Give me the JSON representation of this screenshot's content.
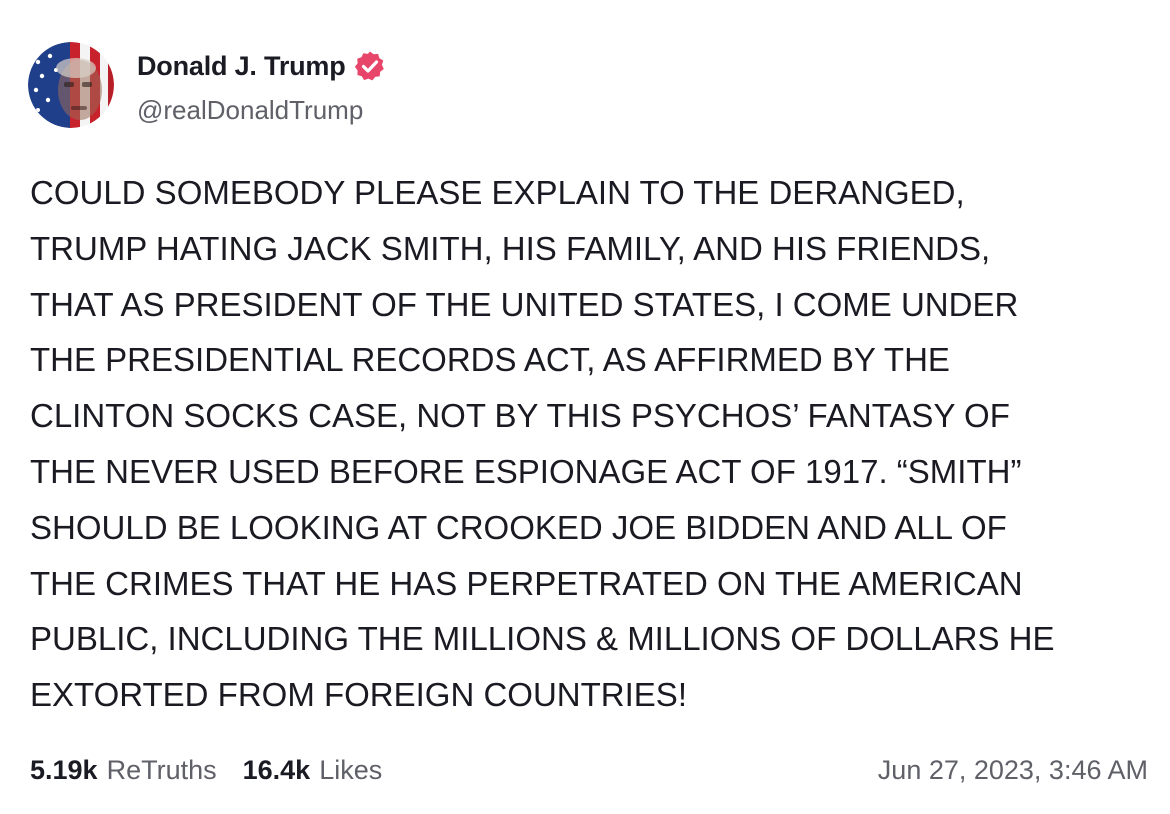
{
  "post": {
    "author": {
      "display_name": "Donald J. Trump",
      "handle": "@realDonaldTrump",
      "verified": true,
      "verified_color": "#e8456a"
    },
    "body": "COULD SOMEBODY PLEASE EXPLAIN TO THE DERANGED,\nTRUMP HATING JACK SMITH, HIS FAMILY, AND HIS FRIENDS,\nTHAT AS PRESIDENT OF THE UNITED STATES, I COME UNDER\nTHE PRESIDENTIAL RECORDS ACT, AS AFFIRMED BY THE\nCLINTON SOCKS CASE, NOT BY THIS PSYCHOS’ FANTASY OF\nTHE NEVER USED BEFORE ESPIONAGE ACT OF 1917. “SMITH”\nSHOULD BE LOOKING AT CROOKED JOE BIDDEN AND ALL OF\nTHE CRIMES THAT HE HAS PERPETRATED ON THE AMERICAN\nPUBLIC, INCLUDING THE MILLIONS & MILLIONS OF DOLLARS HE\nEXTORTED FROM FOREIGN COUNTRIES!",
    "stats": {
      "retruths_count": "5.19k",
      "retruths_label": "ReTruths",
      "likes_count": "16.4k",
      "likes_label": "Likes"
    },
    "timestamp": "Jun 27, 2023, 3:46 AM"
  }
}
